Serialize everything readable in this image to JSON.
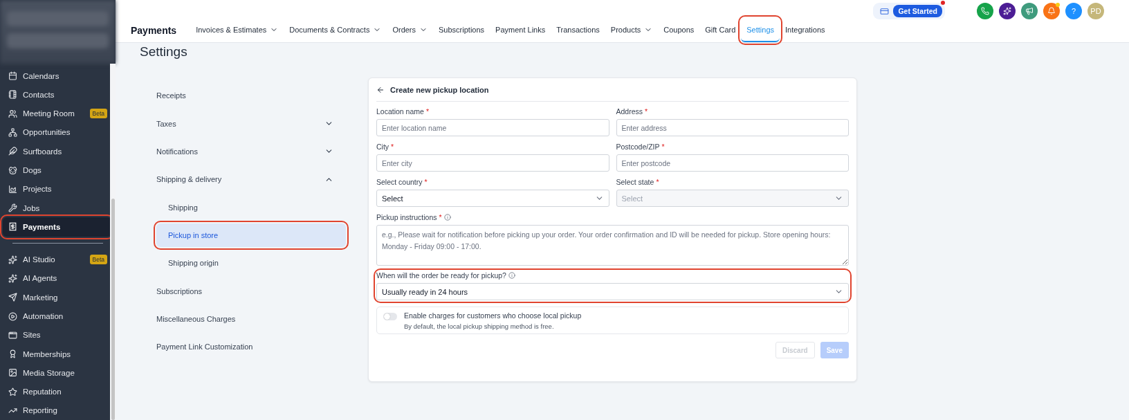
{
  "sidebar": {
    "groups": [
      [
        {
          "label": "Calendars",
          "selected": false,
          "highlighted": false
        },
        {
          "label": "Contacts",
          "selected": false,
          "highlighted": false
        },
        {
          "label": "Meeting Room",
          "badge": "Beta",
          "selected": false,
          "highlighted": false
        },
        {
          "label": "Opportunities",
          "selected": false,
          "highlighted": false
        },
        {
          "label": "Surfboards",
          "selected": false,
          "highlighted": false
        },
        {
          "label": "Dogs",
          "selected": false,
          "highlighted": false
        },
        {
          "label": "Projects",
          "selected": false,
          "highlighted": false
        },
        {
          "label": "Jobs",
          "selected": false,
          "highlighted": false
        },
        {
          "label": "Payments",
          "selected": true,
          "highlighted": true
        }
      ],
      [
        {
          "label": "AI Studio",
          "badge": "Beta",
          "selected": false,
          "highlighted": false
        },
        {
          "label": "AI Agents",
          "selected": false,
          "highlighted": false
        },
        {
          "label": "Marketing",
          "selected": false,
          "highlighted": false
        },
        {
          "label": "Automation",
          "selected": false,
          "highlighted": false
        },
        {
          "label": "Sites",
          "selected": false,
          "highlighted": false
        },
        {
          "label": "Memberships",
          "selected": false,
          "highlighted": false
        },
        {
          "label": "Media Storage",
          "selected": false,
          "highlighted": false
        },
        {
          "label": "Reputation",
          "selected": false,
          "highlighted": false
        },
        {
          "label": "Reporting",
          "selected": false,
          "highlighted": false
        }
      ]
    ]
  },
  "header": {
    "get_started": {
      "label": "Get Started",
      "notification": true
    },
    "round_buttons": [
      {
        "kind": "phone",
        "color": "#16a34a"
      },
      {
        "kind": "sparkle",
        "color": "#4c1d95"
      },
      {
        "kind": "megaphone",
        "color": "#3f9b7d"
      },
      {
        "kind": "bell",
        "color": "#f97316",
        "notification": true
      },
      {
        "kind": "help",
        "label": "?",
        "color": "#1e90ff"
      },
      {
        "kind": "avatar",
        "label": "PD",
        "color": "#c5b77a"
      }
    ]
  },
  "nav": {
    "title": "Payments",
    "tabs": [
      {
        "label": "Invoices & Estimates",
        "has_menu": true,
        "selected": false,
        "highlighted": false
      },
      {
        "label": "Documents & Contracts",
        "has_menu": true,
        "selected": false,
        "highlighted": false
      },
      {
        "label": "Orders",
        "has_menu": true,
        "selected": false,
        "highlighted": false
      },
      {
        "label": "Subscriptions",
        "has_menu": false,
        "selected": false,
        "highlighted": false
      },
      {
        "label": "Payment Links",
        "has_menu": false,
        "selected": false,
        "highlighted": false
      },
      {
        "label": "Transactions",
        "has_menu": false,
        "selected": false,
        "highlighted": false
      },
      {
        "label": "Products",
        "has_menu": true,
        "selected": false,
        "highlighted": false
      },
      {
        "label": "Coupons",
        "has_menu": false,
        "selected": false,
        "highlighted": false
      },
      {
        "label": "Gift Card",
        "has_menu": false,
        "selected": false,
        "highlighted": false
      },
      {
        "label": "Settings",
        "has_menu": false,
        "selected": true,
        "highlighted": true
      },
      {
        "label": "Integrations",
        "has_menu": false,
        "selected": false,
        "highlighted": false
      }
    ]
  },
  "page_title": "Settings",
  "settings_menu": [
    {
      "label": "Receipts",
      "selected": false,
      "highlighted": false
    },
    {
      "label": "Taxes",
      "expanded": false,
      "selected": false,
      "highlighted": false
    },
    {
      "label": "Notifications",
      "expanded": false,
      "selected": false,
      "highlighted": false
    },
    {
      "label": "Shipping & delivery",
      "expanded": true,
      "selected": false,
      "highlighted": false,
      "children": [
        {
          "label": "Shipping",
          "selected": false,
          "highlighted": false
        },
        {
          "label": "Pickup in store",
          "selected": true,
          "highlighted": true
        },
        {
          "label": "Shipping origin",
          "selected": false,
          "highlighted": false
        }
      ]
    },
    {
      "label": "Subscriptions",
      "selected": false,
      "highlighted": false
    },
    {
      "label": "Miscellaneous Charges",
      "selected": false,
      "highlighted": false
    },
    {
      "label": "Payment Link Customization",
      "selected": false,
      "highlighted": false
    }
  ],
  "form": {
    "title": "Create new pickup location",
    "required_mark": "*",
    "fields": [
      {
        "kind": "text",
        "label": "Location name",
        "required": true,
        "placeholder": "Enter location name",
        "disabled": false
      },
      {
        "kind": "text",
        "label": "Address",
        "required": true,
        "placeholder": "Enter address",
        "disabled": false
      },
      {
        "kind": "text",
        "label": "City",
        "required": true,
        "placeholder": "Enter city",
        "disabled": false
      },
      {
        "kind": "text",
        "label": "Postcode/ZIP",
        "required": true,
        "placeholder": "Enter postcode",
        "disabled": false
      },
      {
        "kind": "select",
        "label": "Select country",
        "required": true,
        "value": "Select",
        "disabled": false
      },
      {
        "kind": "select",
        "label": "Select state",
        "required": true,
        "placeholder": "Select",
        "disabled": true
      },
      {
        "kind": "textarea",
        "label": "Pickup instructions",
        "required": true,
        "info": true,
        "placeholder": "e.g., Please wait for notification before picking up your order. Your order confirmation and ID will be needed for pickup. Store opening hours: Monday - Friday 09:00 - 17:00.",
        "disabled": false
      },
      {
        "kind": "select",
        "label": "When will the order be ready for pickup?",
        "required": false,
        "info": true,
        "value": "Usually ready in 24 hours",
        "disabled": false,
        "highlighted": true
      }
    ],
    "toggle": {
      "label": "Enable charges for customers who choose local pickup",
      "description": "By default, the local pickup shipping method is free.",
      "on": false
    },
    "buttons": [
      {
        "label": "Discard",
        "kind": "secondary",
        "disabled": true
      },
      {
        "label": "Save",
        "kind": "primary",
        "disabled": true
      }
    ]
  }
}
